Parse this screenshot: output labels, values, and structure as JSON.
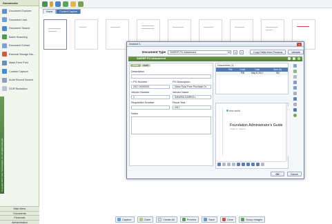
{
  "sidebar": {
    "header": "Documents",
    "items": [
      {
        "label": "Document Explorer",
        "color": "#5a8fd0"
      },
      {
        "label": "Document Lists",
        "color": "#6ea1d8"
      },
      {
        "label": "Document Search",
        "color": "#4f85c9"
      },
      {
        "label": "Batch Scanning",
        "color": "#4a9a52"
      },
      {
        "label": "Document Extract",
        "color": "#7aa2cf"
      },
      {
        "label": "External Storage Ma...",
        "color": "#d05a3d"
      },
      {
        "label": "Mass Form Print",
        "color": "#6c8fb8"
      },
      {
        "label": "Content Capture",
        "color": "#3f8dd0"
      },
      {
        "label": "Audit Record Search",
        "color": "#8aa2bf"
      },
      {
        "label": "DOR Redaction",
        "color": "#b5c4d6"
      }
    ],
    "strip_text": "Copyright 2017 Tyler Technologies, Inc. All rights reserved",
    "bottom_buttons": [
      "Main Menu",
      "Documents",
      "Financials",
      "Administration"
    ]
  },
  "main": {
    "tabs": [
      "Home",
      "Content Capture"
    ],
    "footer_buttons": [
      {
        "label": "Capture",
        "color": "#6a9fd6"
      },
      {
        "label": "Claim",
        "color": "#b9c27a"
      },
      {
        "label": "Create All",
        "color": "#e1e4e9"
      },
      {
        "label": "Preview",
        "color": "#5d9c5a"
      },
      {
        "label": "Save",
        "color": "#6b93c7"
      },
      {
        "label": "Clear",
        "color": "#c25544"
      },
      {
        "label": "Group Images",
        "color": "#5aa05c"
      }
    ]
  },
  "modal": {
    "title": "Instance 1",
    "doc_type_label": "Document Type",
    "doc_type_value": "SWERP PO Attachment",
    "copy_button": "Copy Fields from Previous",
    "validate_button": "Validate",
    "section_title": "SWERP PO Attachment",
    "form_tabs": [
      "Fields",
      "Audit"
    ],
    "fields": {
      "description_label": "Description",
      "description_value": "",
      "po_number_label": "PO Number",
      "po_number_value": "2017-00000001",
      "po_description_label": "PO Description",
      "po_description_value": "Diane Tolar Form Purchase Or",
      "vendor_number_label": "Vendor Number",
      "vendor_number_value": "1",
      "vendor_name_label": "Vendor Name",
      "vendor_name_value": "SANDRA CARROLL",
      "requisition_label": "Requisition Number",
      "requisition_value": "",
      "fiscal_year_label": "Fiscal Year",
      "fiscal_year_value": "2017",
      "notes_label": "Notes",
      "notes_value": ""
    },
    "documents": {
      "title": "Documents (1)",
      "columns": [
        "Title",
        "Code",
        "Date",
        "Size (K)"
      ],
      "rows": [
        {
          "title": "",
          "code": "PIB",
          "date": "May 8, 2017",
          "size": "782"
        }
      ]
    },
    "preview": {
      "logo": "new world",
      "title": "Foundation Administrator's Guide",
      "subtitle": "Version 17 · Systems"
    },
    "ok_button": "OK",
    "cancel_button": "Cancel"
  }
}
